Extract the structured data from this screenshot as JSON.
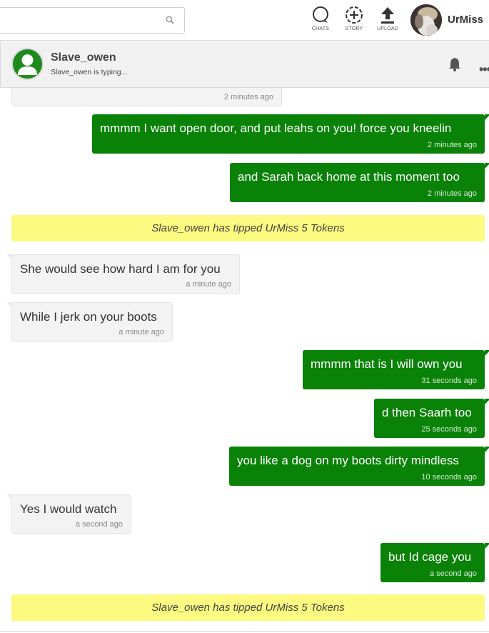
{
  "topbar": {
    "search": {
      "placeholder": "",
      "value": ""
    },
    "nav": [
      {
        "label": "CHATS",
        "icon": "chat-bubble-icon"
      },
      {
        "label": "STORY",
        "icon": "story-add-icon"
      },
      {
        "label": "UPLOAD",
        "icon": "upload-icon"
      }
    ],
    "username": "UrMiss"
  },
  "chat": {
    "contact_name": "Slave_owen",
    "status": "Slave_owen is typing...",
    "accent_color": "#0a8208",
    "tip_color": "#fcfa80"
  },
  "messages": [
    {
      "type": "in",
      "text": "",
      "time": "2 minutes ago"
    },
    {
      "type": "out",
      "text": "mmmm I want open door, and put leahs on you! force you kneelin",
      "time": "2 minutes ago"
    },
    {
      "type": "out",
      "text": "and Sarah back home at this moment too",
      "time": "2 minutes ago"
    },
    {
      "type": "tip",
      "text": "Slave_owen has tipped UrMiss 5 Tokens"
    },
    {
      "type": "in",
      "text": "She would see how hard I am for you",
      "time": "a minute ago"
    },
    {
      "type": "in",
      "text": "While I jerk on your boots",
      "time": "a minute ago"
    },
    {
      "type": "out",
      "text": "mmmm that is I will own you",
      "time": "31 seconds ago"
    },
    {
      "type": "out",
      "text": "d then Saarh too",
      "time": "25 seconds ago"
    },
    {
      "type": "out",
      "text": "you like a dog on my boots dirty mindless",
      "time": "10 seconds ago"
    },
    {
      "type": "in",
      "text": "Yes I would watch",
      "time": "a second ago"
    },
    {
      "type": "out",
      "text": "but Id cage you",
      "time": "a second ago"
    },
    {
      "type": "tip",
      "text": "Slave_owen has tipped UrMiss 5 Tokens"
    }
  ]
}
